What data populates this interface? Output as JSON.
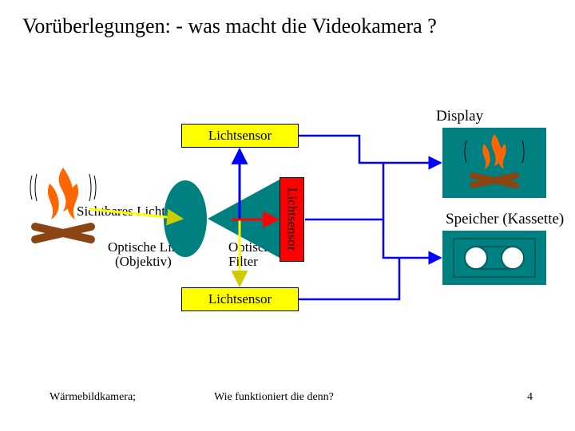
{
  "title": "Vorüberlegungen:   - was macht die Videokamera ?",
  "labels": {
    "display": "Display",
    "lichtsensor_top": "Lichtsensor",
    "lichtsensor_right": "Lichtsensor",
    "lichtsensor_bottom": "Lichtsensor",
    "sichtbares_licht": "Sichtbares Licht",
    "optische_linse1": "Optische Linse",
    "optische_linse2": "(Objektiv)",
    "optisches_filter1": "Optisches",
    "optisches_filter2": "Filter",
    "speicher": "Speicher (Kassette)"
  },
  "footer": {
    "left": "Wärmebildkamera;",
    "center": "Wie funktioniert die denn?",
    "page": "4"
  },
  "colors": {
    "yellow": "#ffff00",
    "red": "#ff0000",
    "blue": "#0000ff",
    "teal": "#008080",
    "orange": "#ff6600",
    "brown": "#8b4513",
    "dark_teal": "#006060"
  }
}
